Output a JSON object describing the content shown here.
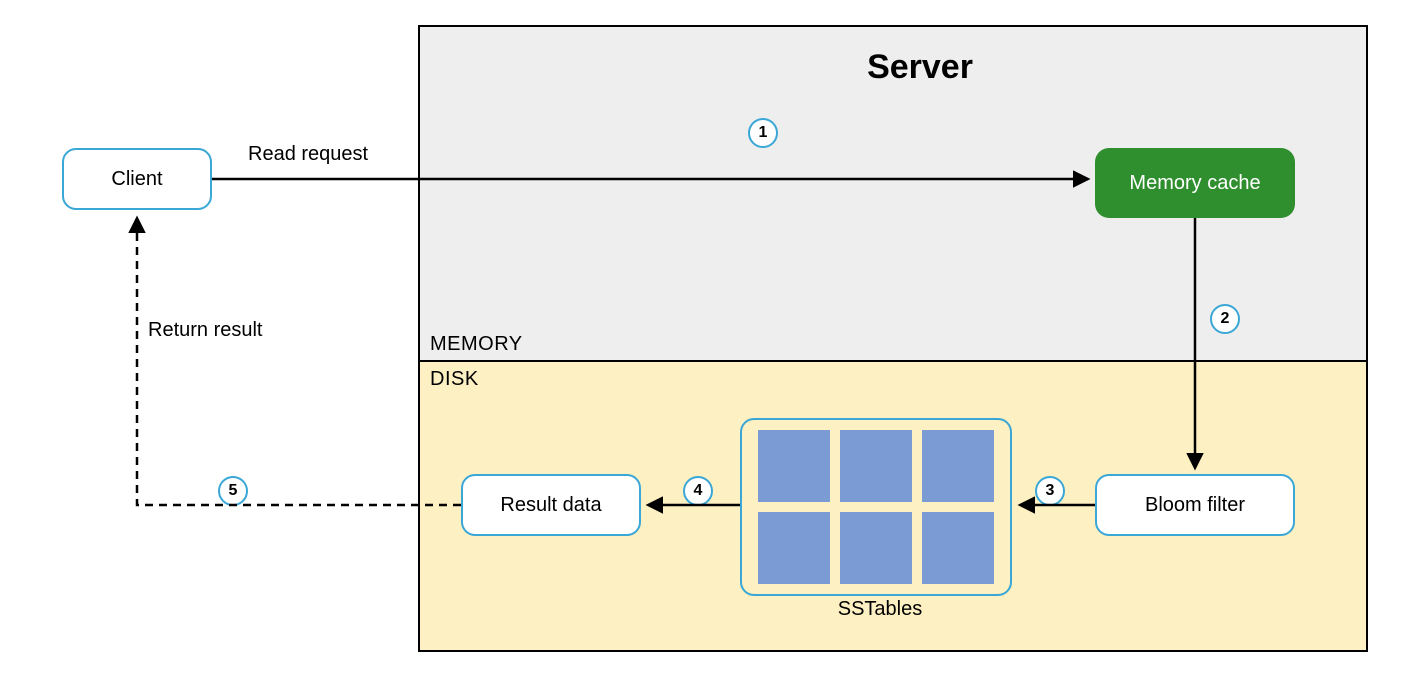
{
  "server": {
    "title": "Server"
  },
  "regions": {
    "memory": {
      "label": "MEMORY"
    },
    "disk": {
      "label": "DISK"
    }
  },
  "nodes": {
    "client": {
      "label": "Client"
    },
    "memory_cache": {
      "label": "Memory cache"
    },
    "bloom_filter": {
      "label": "Bloom filter"
    },
    "sstables": {
      "label": "SSTables"
    },
    "result_data": {
      "label": "Result data"
    }
  },
  "edges": {
    "read_request": {
      "label": "Read request"
    },
    "return_result": {
      "label": "Return result"
    }
  },
  "steps": {
    "s1": "1",
    "s2": "2",
    "s3": "3",
    "s4": "4",
    "s5": "5"
  },
  "colors": {
    "outline": "#3ba7d6",
    "green": "#2f8f2f",
    "memory_bg": "#eeeeee",
    "disk_bg": "#fdf0c2",
    "sstable": "#7a9bd4"
  }
}
